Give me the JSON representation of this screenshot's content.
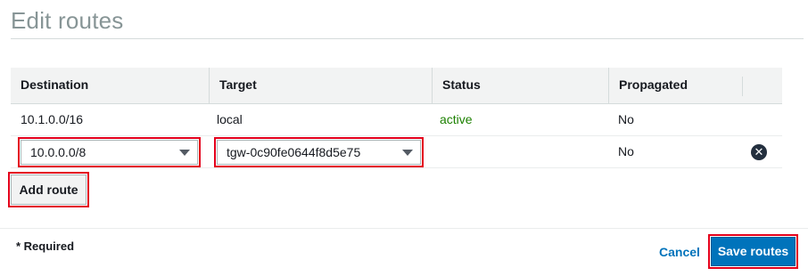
{
  "page": {
    "title": "Edit routes"
  },
  "table": {
    "columns": [
      "Destination",
      "Target",
      "Status",
      "Propagated"
    ],
    "rows": [
      {
        "destination": "10.1.0.0/16",
        "target": "local",
        "status": "active",
        "propagated": "No"
      },
      {
        "destination": "10.0.0.0/8",
        "target": "tgw-0c90fe0644f8d5e75",
        "status": "",
        "propagated": "No"
      }
    ]
  },
  "actions": {
    "add_route": "Add route",
    "required_note": "* Required",
    "cancel": "Cancel",
    "save": "Save routes"
  },
  "colors": {
    "status_active": "#1d8102",
    "primary_button": "#0073bb",
    "highlight_outline": "#e3001b"
  },
  "icons": {
    "remove_row": "close-circle-icon",
    "dropdown": "caret-down-icon"
  }
}
